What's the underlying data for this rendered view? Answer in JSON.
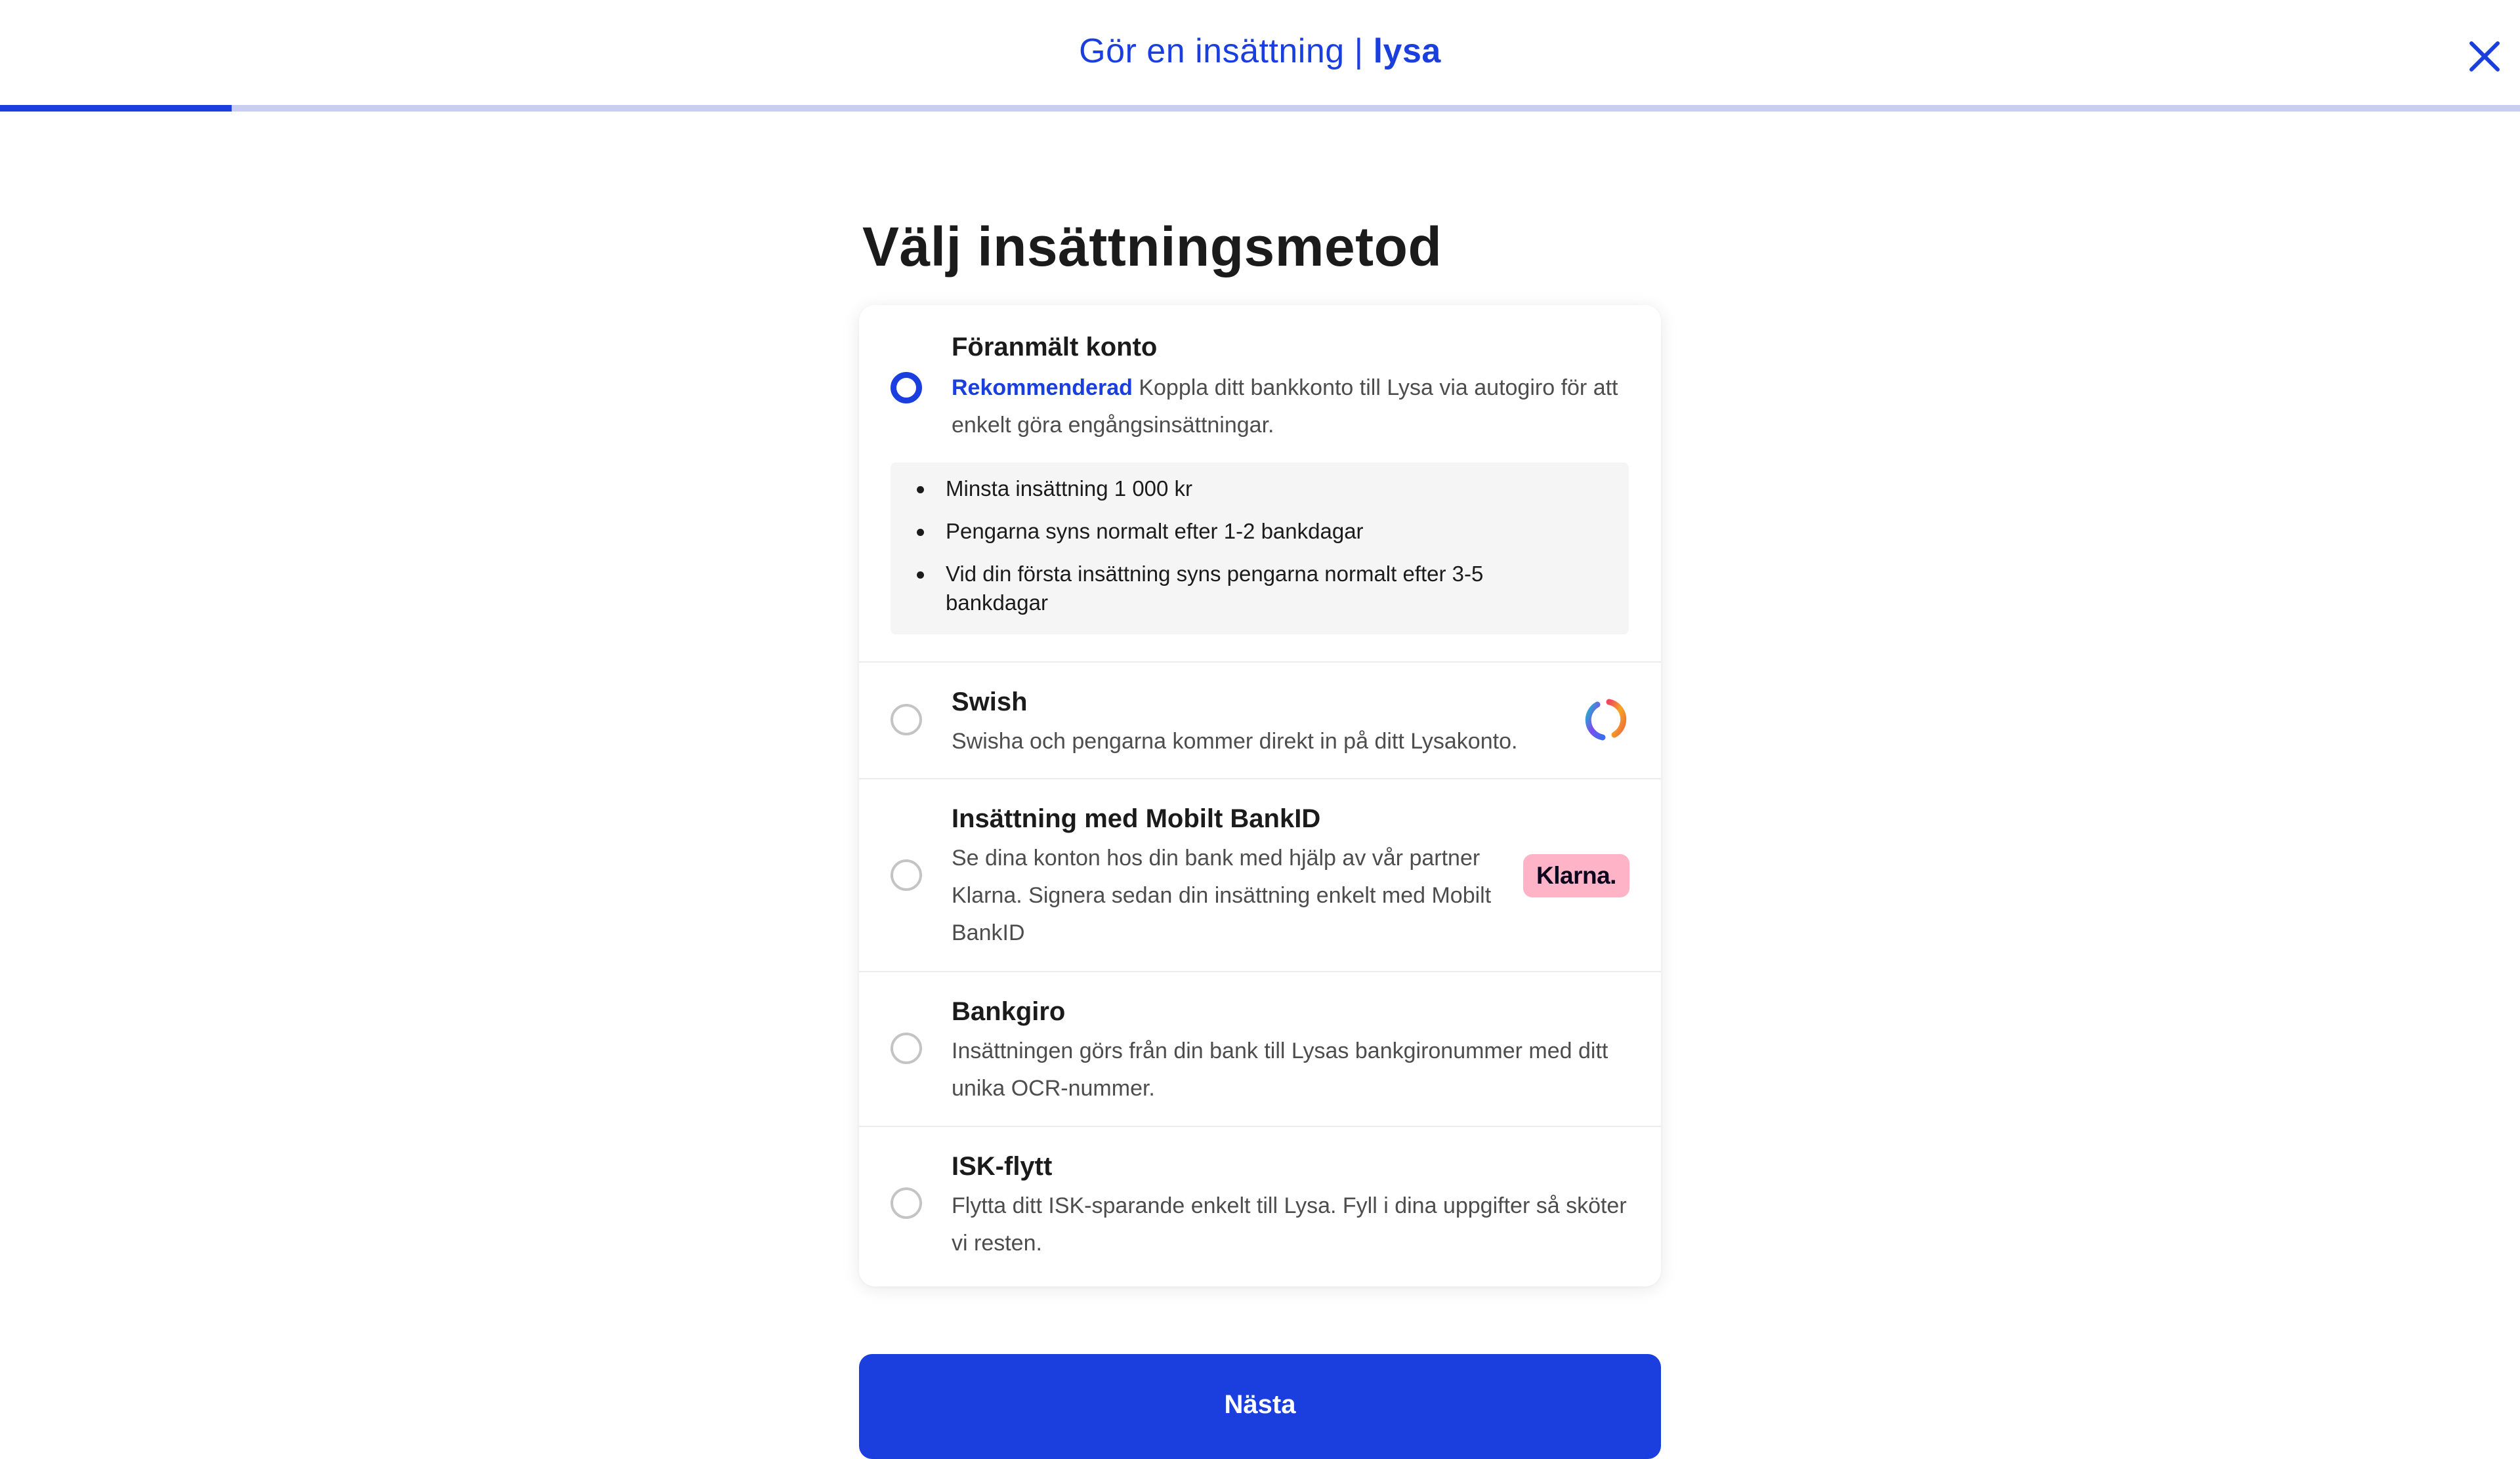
{
  "header": {
    "title": "Gör en insättning |",
    "brand": "lysa",
    "close_icon": "close-icon",
    "progress_fraction": 0.092
  },
  "page_title": "Välj insättningsmetod",
  "options": [
    {
      "title": "Föranmält konto",
      "badge": "Rekommenderad",
      "description": "Koppla ditt bankkonto till Lysa via autogiro för att enkelt göra engångsinsättningar.",
      "selected": true,
      "details": [
        "Minsta insättning 1 000 kr",
        "Pengarna syns normalt efter 1-2 bankdagar",
        "Vid din första insättning syns pengarna normalt efter 3-5 bankdagar"
      ]
    },
    {
      "title": "Swish",
      "description": "Swisha och pengarna kommer direkt in på ditt Lysakonto.",
      "selected": false,
      "logo": "swish-logo-icon"
    },
    {
      "title": "Insättning med Mobilt BankID",
      "description": "Se dina konton hos din bank med hjälp av vår partner Klarna. Signera sedan din insättning enkelt med Mobilt BankID",
      "selected": false,
      "logo_text": "Klarna."
    },
    {
      "title": "Bankgiro",
      "description": "Insättningen görs från din bank till Lysas bankgironummer med ditt unika OCR-nummer.",
      "selected": false
    },
    {
      "title": "ISK-flytt",
      "description": "Flytta ditt ISK-sparande enkelt till Lysa. Fyll i dina uppgifter så sköter vi resten.",
      "selected": false
    }
  ],
  "next_button": "Nästa",
  "colors": {
    "accent": "#1a3fde",
    "progress_track": "#c9cdf0",
    "klarna_pink": "#ffb3c7"
  }
}
